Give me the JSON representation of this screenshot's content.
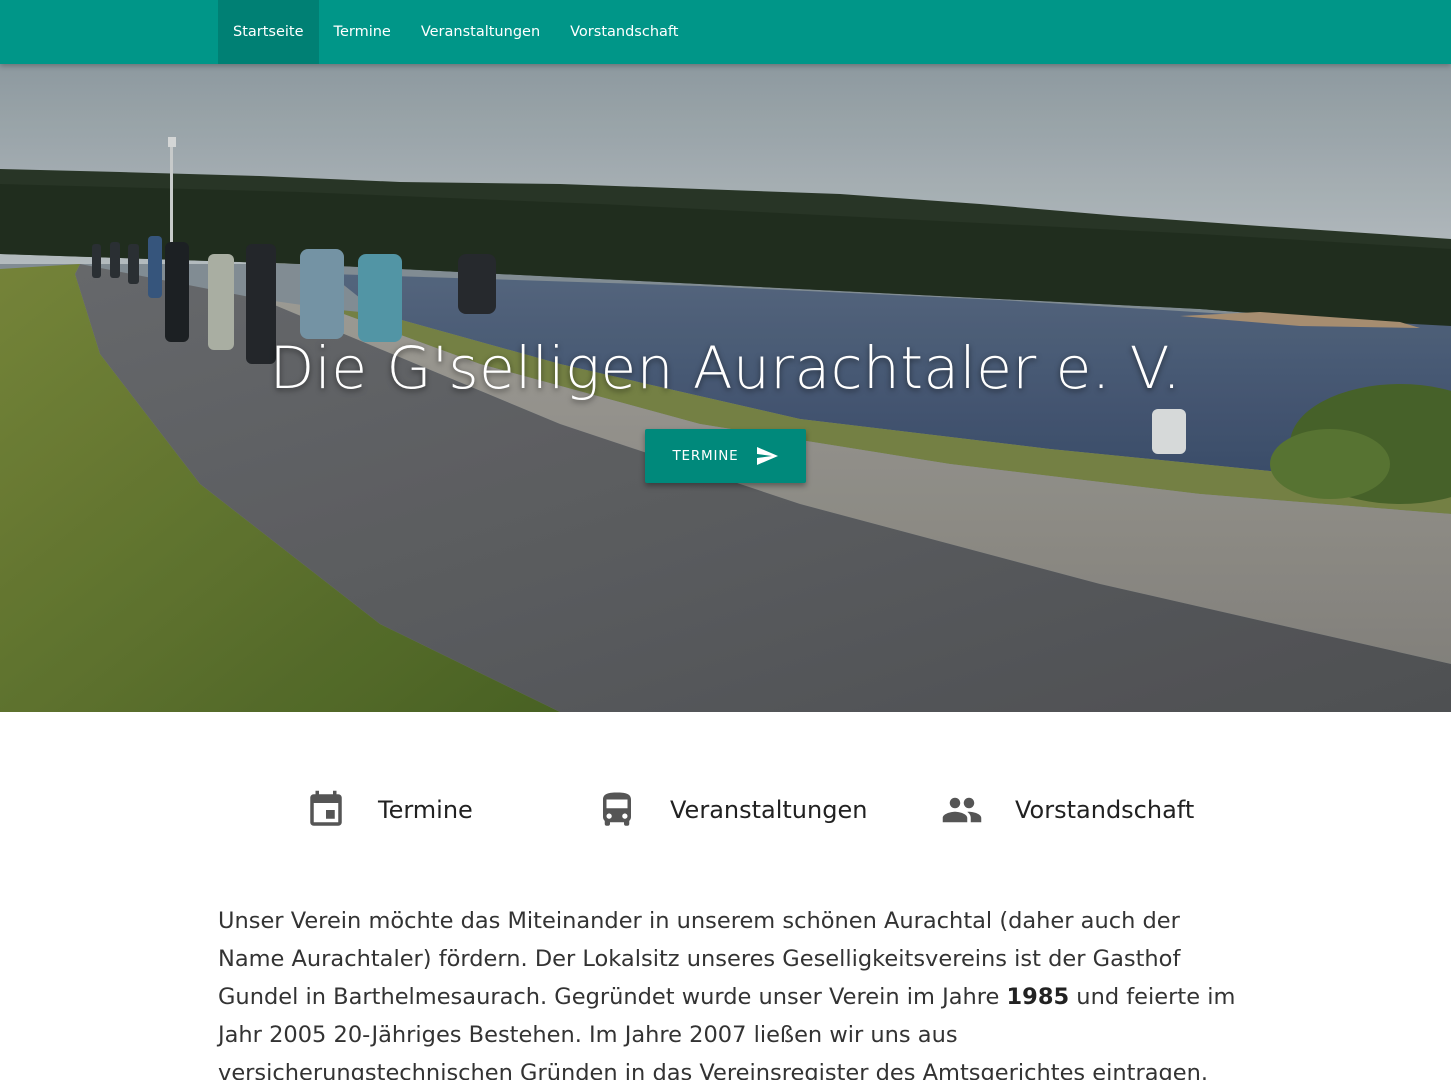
{
  "nav": {
    "items": [
      {
        "label": "Startseite",
        "active": true
      },
      {
        "label": "Termine",
        "active": false
      },
      {
        "label": "Veranstaltungen",
        "active": false
      },
      {
        "label": "Vorstandschaft",
        "active": false
      }
    ]
  },
  "hero": {
    "title": "Die G'selligen Aurachtaler e. V.",
    "button_label": "TERMINE",
    "button_icon": "send-icon"
  },
  "features": [
    {
      "icon": "calendar-icon",
      "label": "Termine"
    },
    {
      "icon": "bus-icon",
      "label": "Veranstaltungen"
    },
    {
      "icon": "people-icon",
      "label": "Vorstandschaft"
    }
  ],
  "intro": {
    "part1": "Unser Verein möchte das Miteinander in unserem schönen Aurachtal (daher auch der Name Aurachtaler) fördern. Der Lokalsitz unseres Geselligkeitsvereins ist der Gasthof Gundel in Barthelmesaurach. Gegründet wurde unser Verein im Jahre ",
    "year": "1985",
    "part2": " und feierte im Jahr 2005 20-Jähriges Bestehen. Im Jahre 2007 ließen wir uns aus versicherungstechnischen Gründen in das Vereinsregister des Amtsgerichtes eintragen."
  },
  "colors": {
    "primary": "#009688",
    "button": "#00897b",
    "icon": "#555555"
  }
}
